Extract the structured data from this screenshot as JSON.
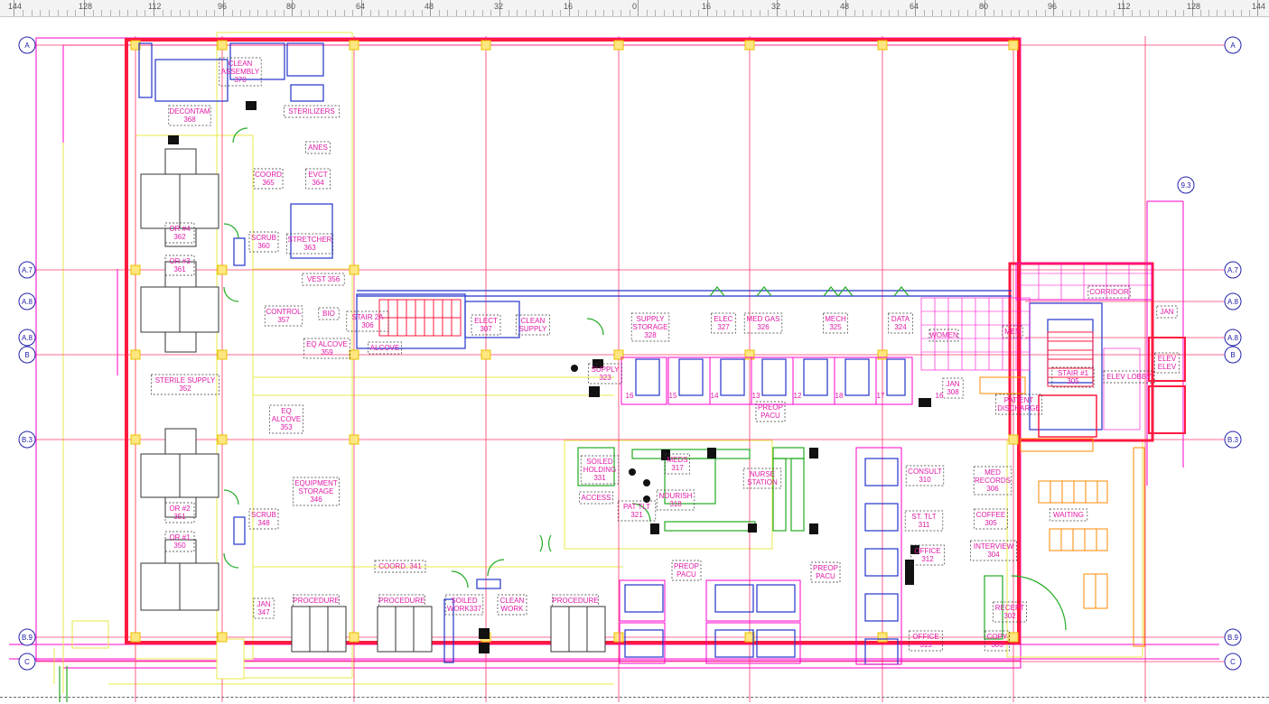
{
  "ruler": {
    "labels": [
      "144",
      "128",
      "112",
      "96",
      "80",
      "64",
      "48",
      "32",
      "16",
      "0",
      "16",
      "32",
      "48",
      "64",
      "80",
      "96",
      "112",
      "128",
      "144"
    ]
  },
  "gridlines": {
    "rows": [
      "A",
      "A.7",
      "A.8",
      "A.8",
      "B",
      "B.3",
      "B.9",
      "C"
    ],
    "extra": "9.3"
  },
  "rooms": {
    "clean_assembly": [
      "CLEAN",
      "ASSEMBLY",
      "370"
    ],
    "decontam": [
      "DECONTAM",
      "368"
    ],
    "sterilizers": [
      "STERILIZERS"
    ],
    "anes": [
      "ANES"
    ],
    "coord_365": [
      "COORD",
      "365"
    ],
    "evct": [
      "EVCT",
      "364"
    ],
    "or4": [
      "OR #4",
      "362"
    ],
    "scrub360": [
      "SCRUB",
      "360"
    ],
    "stretcher": [
      "STRETCHER",
      "363"
    ],
    "or3": [
      "OR #3",
      "361"
    ],
    "vest": [
      "VEST 356"
    ],
    "control": [
      "CONTROL",
      "357"
    ],
    "bio": [
      "BIO"
    ],
    "stair2a": [
      "STAIR 2A",
      "306"
    ],
    "elect": [
      "ELECT",
      "307"
    ],
    "clean_supply": [
      "CLEAN",
      "SUPPLY"
    ],
    "eq_alcove_359": [
      "EQ ALCOVE",
      "359"
    ],
    "alcove": [
      "ALCOVE"
    ],
    "supply_storage": [
      "SUPPLY",
      "STORAGE",
      "328"
    ],
    "elec": [
      "ELEC",
      "327"
    ],
    "med_gas": [
      "MED GAS",
      "326"
    ],
    "mech": [
      "MECH",
      "325"
    ],
    "data": [
      "DATA",
      "324"
    ],
    "sterile_supply": [
      "STERILE SUPPLY",
      "352"
    ],
    "eq_alcove_353": [
      "EQ",
      "ALCOVE",
      "353"
    ],
    "supply_323": [
      "SUPPLY",
      "323"
    ],
    "precop_pacu_top": [
      "PREOP",
      "PACU"
    ],
    "jan308": [
      "JAN",
      "308"
    ],
    "patient_discharge": [
      "PATIENT",
      "DISCHARGE"
    ],
    "stair1": [
      "STAIR #1",
      "305"
    ],
    "elev_lobby": [
      "ELEV LOBBY"
    ],
    "elev": [
      "ELEV",
      "ELEV"
    ],
    "corridor": [
      "CORRIDOR"
    ],
    "jan": [
      "JAN"
    ],
    "toilet_men": [
      "MEN"
    ],
    "toilet_women": [
      "WOMEN"
    ],
    "soiled_holding": [
      "SOILED",
      "HOLDING",
      "331"
    ],
    "meds": [
      "MEDS",
      "317"
    ],
    "nurse_station": [
      "NURSE",
      "STATION"
    ],
    "consult": [
      "CONSULT",
      "310"
    ],
    "med_records": [
      "MED",
      "RECORDS",
      "306"
    ],
    "access": [
      "ACCESS"
    ],
    "nourish": [
      "NOURISH",
      "318"
    ],
    "pat_tlt": [
      "PAT TLT",
      "321"
    ],
    "staff_tlt": [
      "ST. TLT",
      "311"
    ],
    "coffee": [
      "COFFEE",
      "305"
    ],
    "waiting": [
      "WAITING"
    ],
    "equipment_storage": [
      "EQUIPMENT",
      "STORAGE",
      "346"
    ],
    "or2": [
      "OR #2",
      "351"
    ],
    "scrub348": [
      "SCRUB",
      "348"
    ],
    "or1": [
      "OR #1",
      "350"
    ],
    "office312": [
      "OFFICE",
      "312"
    ],
    "interview": [
      "INTERVIEW",
      "304"
    ],
    "coord341": [
      "COORD. 341"
    ],
    "preop_pacu_a": [
      "PREOP",
      "PACU"
    ],
    "preop_pacu_b": [
      "PREOP",
      "PACU"
    ],
    "jan347": [
      "JAN",
      "347"
    ],
    "procedure_a": [
      "PROCEDURE"
    ],
    "procedure_b": [
      "PROCEDURE"
    ],
    "soiled_work": [
      "SOILED",
      "WORK337"
    ],
    "clean_work": [
      "CLEAN",
      "WORK"
    ],
    "procedure_c": [
      "PROCEDURE"
    ],
    "reception": [
      "RECEPT",
      "302"
    ],
    "office313": [
      "OFFICE",
      "313"
    ],
    "copy": [
      "COPY",
      "303"
    ]
  },
  "bays": [
    "16",
    "15",
    "14",
    "13",
    "12",
    "18",
    "17",
    "16"
  ],
  "colors": {
    "wall": "#ff1a40",
    "grid": "#ff3a6a",
    "ruler_bg": "#f3f3f3",
    "label": "#e01aa6",
    "dim": "#ff00cc",
    "yellow": "#e8e84a",
    "green": "#22aa22",
    "blue": "#2233cc",
    "orange": "#ff8800"
  }
}
